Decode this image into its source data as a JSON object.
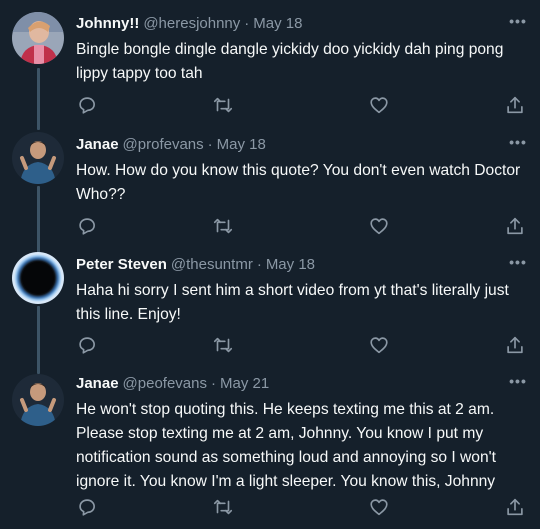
{
  "tweets": [
    {
      "name": "Johnny!!",
      "handle": "@heresjohnny",
      "separator": "·",
      "date": "May 18",
      "text": "Bingle bongle dingle dangle yickidy doo yickidy dah ping pong lippy tappy too tah",
      "more": "•••"
    },
    {
      "name": "Janae",
      "handle": "@profevans",
      "separator": "·",
      "date": "May 18",
      "text": "How. How do you know this quote? You don't even watch Doctor Who??",
      "more": "•••"
    },
    {
      "name": "Peter Steven",
      "handle": "@thesuntmr",
      "separator": "·",
      "date": "May 18",
      "text": "Haha hi sorry I sent him a short video from yt that's literally just this line. Enjoy!",
      "more": "•••"
    },
    {
      "name": "Janae",
      "handle": "@peofevans",
      "separator": "·",
      "date": "May 21",
      "text": "He won't stop quoting this. He keeps texting me this at 2 am. Please stop texting me at 2 am, Johnny. You know I put my notification sound as something loud and annoying so I won't ignore it. You know I'm a light sleeper. You know this, Johnny",
      "more": "•••"
    }
  ],
  "icons": {
    "reply": "reply-icon",
    "retweet": "retweet-icon",
    "like": "like-icon",
    "share": "share-icon",
    "more": "more-icon"
  },
  "colors": {
    "background": "#15202b",
    "text": "#f7f9f9",
    "secondary": "#8b98a5",
    "thread_line": "#3d5466"
  }
}
